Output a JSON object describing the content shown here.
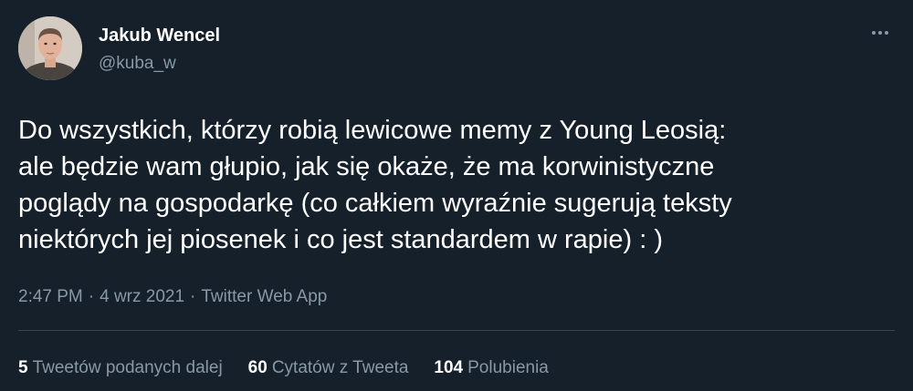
{
  "author": {
    "display_name": "Jakub Wencel",
    "handle": "@kuba_w"
  },
  "tweet": {
    "text": "Do wszystkich, którzy robią lewicowe memy z Young Leosią:\nale będzie wam głupio, jak się okaże, że ma korwinistyczne\npoglądy na gospodarkę (co całkiem wyraźnie sugerują teksty\nniektórych jej piosenek i co jest standardem w rapie) : )",
    "time": "2:47 PM",
    "date": "4 wrz 2021",
    "source": "Twitter Web App"
  },
  "stats": {
    "retweets": {
      "count": "5",
      "label": "Tweetów podanych dalej"
    },
    "quotes": {
      "count": "60",
      "label": "Cytatów z Tweeta"
    },
    "likes": {
      "count": "104",
      "label": "Polubienia"
    }
  },
  "icons": {
    "more": "more-horizontal-icon"
  },
  "colors": {
    "background": "#15202b",
    "primary_text": "#ffffff",
    "secondary_text": "#8899a6",
    "divider": "#38444d"
  }
}
